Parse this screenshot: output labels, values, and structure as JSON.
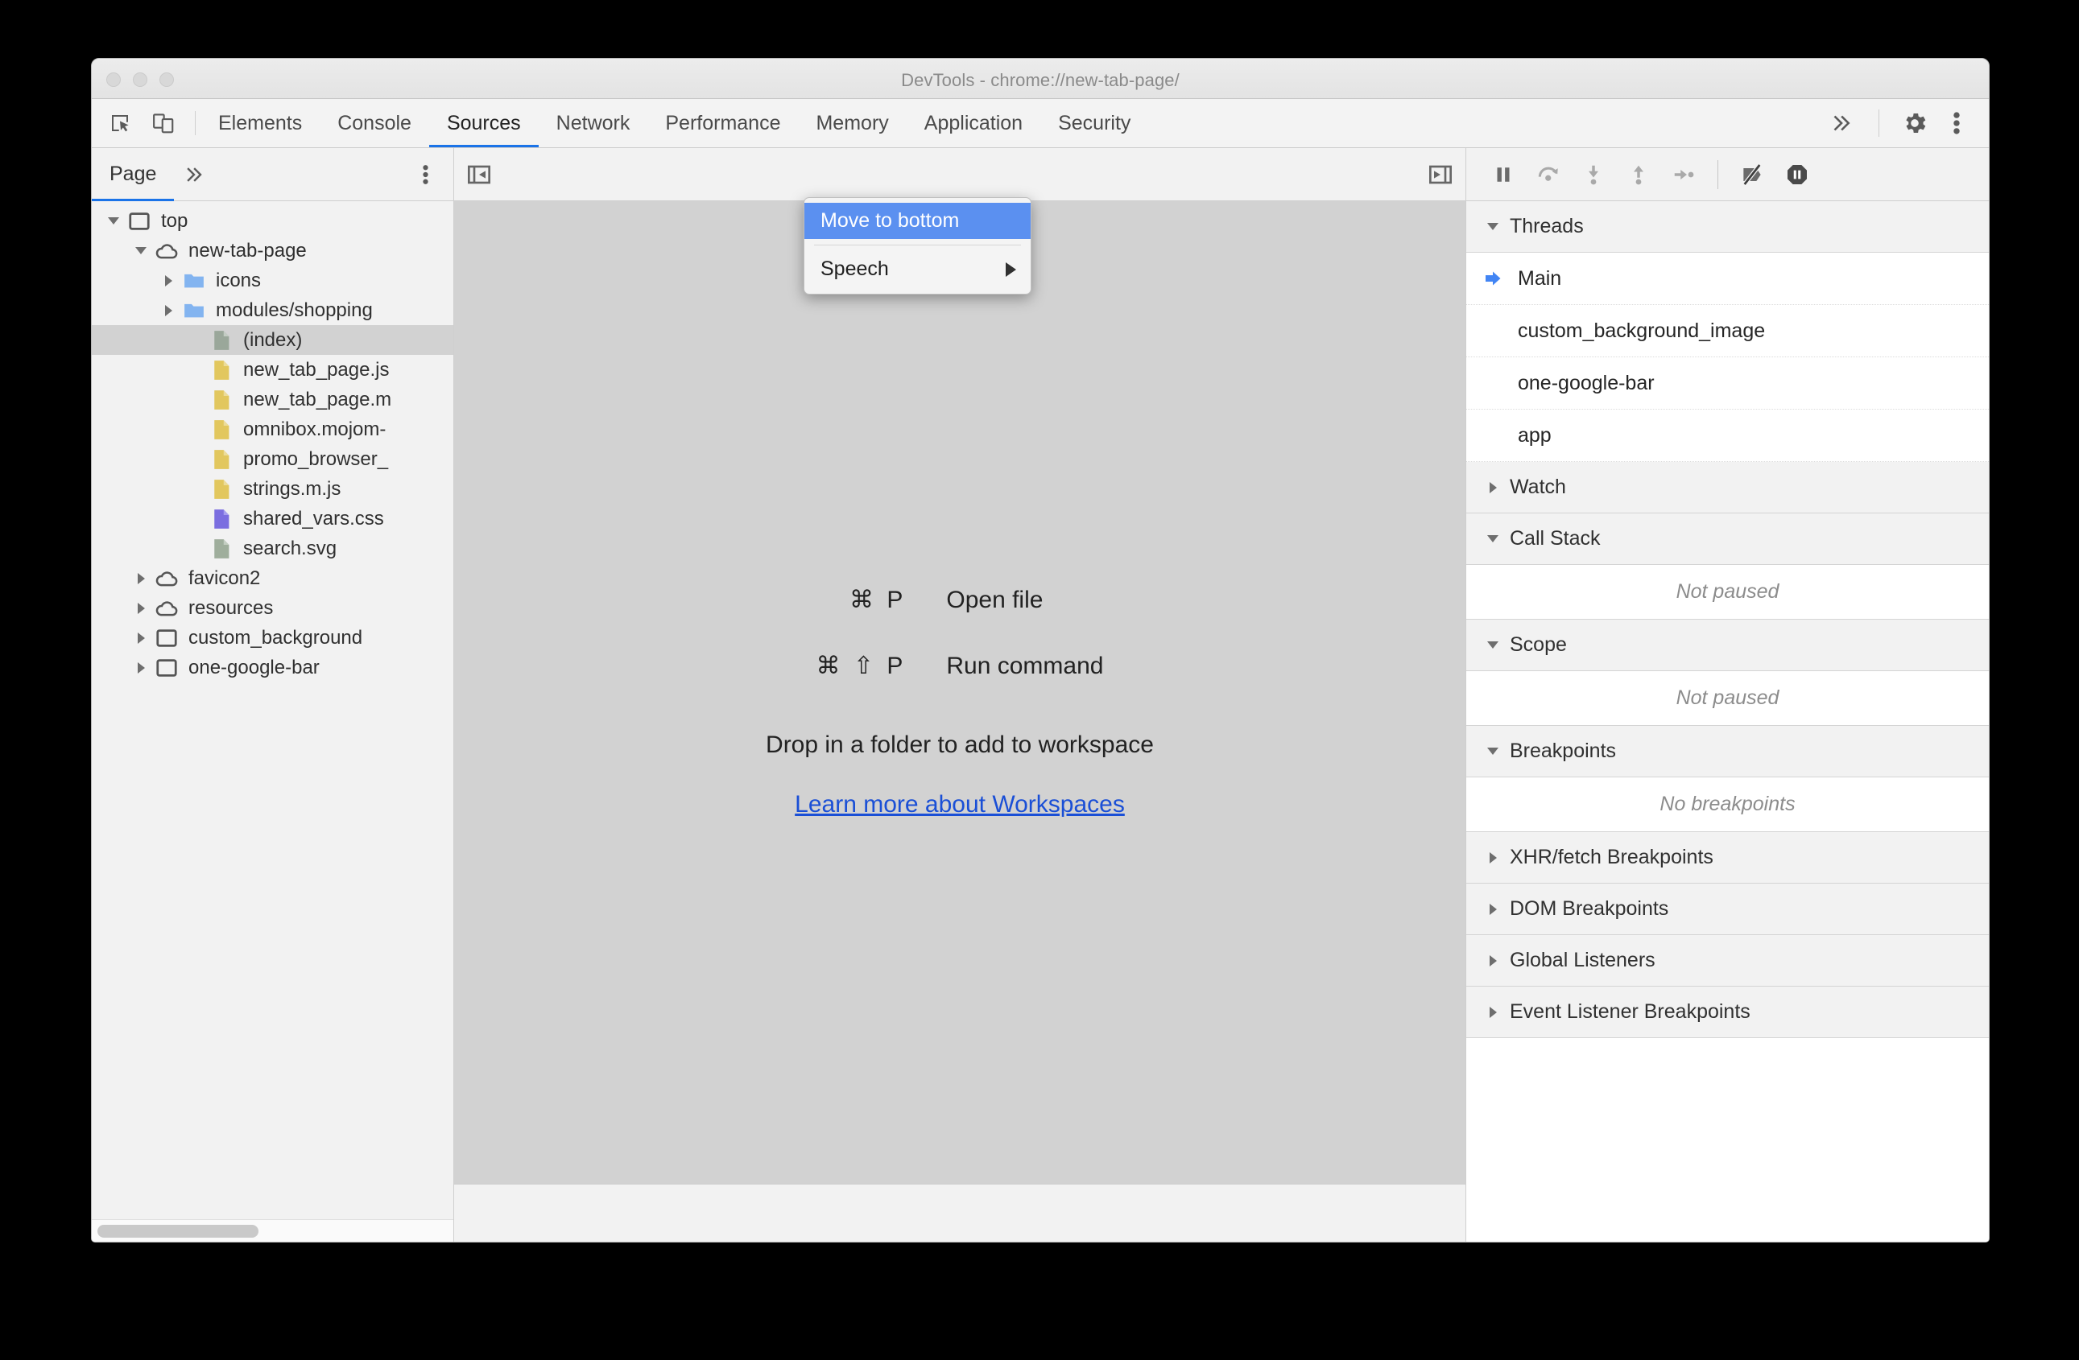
{
  "window": {
    "title": "DevTools - chrome://new-tab-page/",
    "traffic_lights": [
      "close",
      "minimize",
      "maximize"
    ]
  },
  "toolbar": {
    "inspect_icon": "inspect-element-icon",
    "device_icon": "device-toolbar-icon",
    "tabs": [
      {
        "label": "Elements",
        "selected": false
      },
      {
        "label": "Console",
        "selected": false
      },
      {
        "label": "Sources",
        "selected": true
      },
      {
        "label": "Network",
        "selected": false
      },
      {
        "label": "Performance",
        "selected": false
      },
      {
        "label": "Memory",
        "selected": false
      },
      {
        "label": "Application",
        "selected": false
      },
      {
        "label": "Security",
        "selected": false
      }
    ],
    "overflow_icon": "chevron-double-right-icon",
    "settings_icon": "gear-icon",
    "more_icon": "kebab-menu-icon"
  },
  "context_menu": {
    "items": [
      {
        "label": "Move to bottom",
        "highlighted": true,
        "submenu": false
      },
      {
        "label": "Speech",
        "highlighted": false,
        "submenu": true
      }
    ]
  },
  "navigator": {
    "tab_label": "Page",
    "more_tabs_icon": "chevron-double-right-icon",
    "menu_icon": "kebab-menu-icon",
    "tree": [
      {
        "label": "top",
        "icon": "frame-icon",
        "indent": 0,
        "twisty": "open",
        "selected": false
      },
      {
        "label": "new-tab-page",
        "icon": "cloud-icon",
        "indent": 1,
        "twisty": "open",
        "selected": false
      },
      {
        "label": "icons",
        "icon": "folder-icon",
        "indent": 2,
        "twisty": "closed",
        "selected": false
      },
      {
        "label": "modules/shopping",
        "icon": "folder-icon",
        "indent": 2,
        "twisty": "closed",
        "selected": false
      },
      {
        "label": "(index)",
        "icon": "doc-gray-icon",
        "indent": 3,
        "twisty": "none",
        "selected": true
      },
      {
        "label": "new_tab_page.js",
        "icon": "doc-js-icon",
        "indent": 3,
        "twisty": "none",
        "selected": false
      },
      {
        "label": "new_tab_page.m",
        "icon": "doc-js-icon",
        "indent": 3,
        "twisty": "none",
        "selected": false
      },
      {
        "label": "omnibox.mojom-",
        "icon": "doc-js-icon",
        "indent": 3,
        "twisty": "none",
        "selected": false
      },
      {
        "label": "promo_browser_",
        "icon": "doc-js-icon",
        "indent": 3,
        "twisty": "none",
        "selected": false
      },
      {
        "label": "strings.m.js",
        "icon": "doc-js-icon",
        "indent": 3,
        "twisty": "none",
        "selected": false
      },
      {
        "label": "shared_vars.css",
        "icon": "doc-css-icon",
        "indent": 3,
        "twisty": "none",
        "selected": false
      },
      {
        "label": "search.svg",
        "icon": "doc-svg-icon",
        "indent": 3,
        "twisty": "none",
        "selected": false
      },
      {
        "label": "favicon2",
        "icon": "cloud-icon",
        "indent": 1,
        "twisty": "closed",
        "selected": false
      },
      {
        "label": "resources",
        "icon": "cloud-icon",
        "indent": 1,
        "twisty": "closed",
        "selected": false
      },
      {
        "label": "custom_background",
        "icon": "frame-icon",
        "indent": 1,
        "twisty": "closed",
        "selected": false
      },
      {
        "label": "one-google-bar",
        "icon": "frame-icon",
        "indent": 1,
        "twisty": "closed",
        "selected": false
      }
    ]
  },
  "editor": {
    "collapse_navigator_icon": "show-navigator-icon",
    "collapse_debugger_icon": "show-debugger-icon",
    "shortcuts": [
      {
        "keys": "⌘ P",
        "description": "Open file"
      },
      {
        "keys": "⌘ ⇧ P",
        "description": "Run command"
      }
    ],
    "drop_hint": "Drop in a folder to add to workspace",
    "learn_more_link": "Learn more about Workspaces"
  },
  "debugger": {
    "buttons": [
      {
        "name": "resume-script-execution-icon"
      },
      {
        "name": "step-over-icon"
      },
      {
        "name": "step-into-icon"
      },
      {
        "name": "step-out-icon"
      },
      {
        "name": "step-icon"
      },
      {
        "name": "deactivate-breakpoints-icon"
      },
      {
        "name": "pause-on-exceptions-icon"
      }
    ],
    "sections": [
      {
        "title": "Threads",
        "expanded": true,
        "threads": [
          {
            "name": "Main",
            "active": true
          },
          {
            "name": "custom_background_image",
            "active": false
          },
          {
            "name": "one-google-bar",
            "active": false
          },
          {
            "name": "app",
            "active": false
          }
        ]
      },
      {
        "title": "Watch",
        "expanded": false
      },
      {
        "title": "Call Stack",
        "expanded": true,
        "empty_text": "Not paused"
      },
      {
        "title": "Scope",
        "expanded": true,
        "empty_text": "Not paused"
      },
      {
        "title": "Breakpoints",
        "expanded": true,
        "empty_text": "No breakpoints"
      },
      {
        "title": "XHR/fetch Breakpoints",
        "expanded": false
      },
      {
        "title": "DOM Breakpoints",
        "expanded": false
      },
      {
        "title": "Global Listeners",
        "expanded": false
      },
      {
        "title": "Event Listener Breakpoints",
        "expanded": false
      }
    ]
  },
  "colors": {
    "accent": "#1a73e8",
    "menu_highlight": "#5b90f0",
    "link": "#1a4fd6",
    "editor_bg": "#d2d2d2",
    "panel_bg": "#f2f2f2"
  }
}
